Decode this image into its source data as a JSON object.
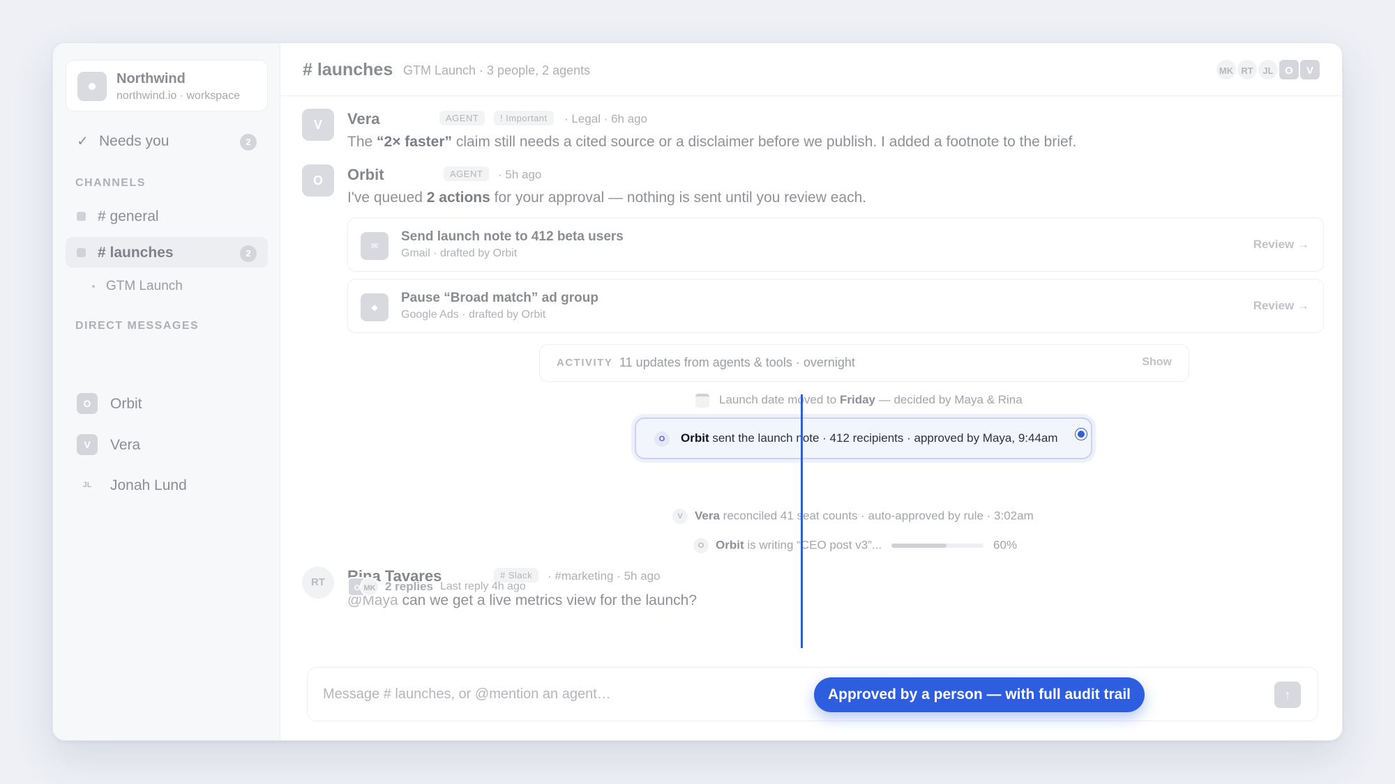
{
  "workspace": {
    "name": "Northwind",
    "subtitle": "northwind.io · workspace"
  },
  "sidebar": {
    "needs_you": {
      "label": "Needs you",
      "count": "2"
    },
    "channels_heading": "CHANNELS",
    "channels": [
      {
        "label": "# general"
      },
      {
        "label": "# launches",
        "count": "2"
      }
    ],
    "sub_item": "GTM Launch",
    "dm_heading": "DIRECT MESSAGES",
    "dms": [
      {
        "initials": "O",
        "label": "Orbit"
      },
      {
        "initials": "V",
        "label": "Vera"
      },
      {
        "initials": "JL",
        "label": "Jonah Lund"
      }
    ]
  },
  "header": {
    "title": "# launches",
    "meta": "GTM Launch · 3 people, 2 agents",
    "avatars": [
      "MK",
      "RT",
      "JL",
      "O",
      "V"
    ]
  },
  "messages": {
    "vera": {
      "avatar": "V",
      "name": "Vera",
      "badge": "AGENT",
      "tag": "! Important",
      "meta": "· Legal · 6h ago",
      "text_pre": "The ",
      "text_bold": "“2× faster”",
      "text_post": " claim still needs a cited source or a disclaimer before we publish. I added a footnote to the brief."
    },
    "orbit": {
      "avatar": "O",
      "name": "Orbit",
      "badge": "AGENT",
      "meta": "· 5h ago",
      "text_pre": "I've queued ",
      "text_bold": "2 actions",
      "text_post": " for your approval — nothing is sent until you review each."
    },
    "rina": {
      "avatar": "RT",
      "name": "Rina Tavares",
      "tag": "# Slack",
      "meta": "· #marketing · 5h ago",
      "mention": "@Maya",
      "text": " can we get a live metrics view for the launch?",
      "reply_avatars": [
        "O",
        "MK"
      ],
      "replies": "2 replies",
      "last_reply": "Last reply 4h ago"
    }
  },
  "actions": [
    {
      "icon": "✉",
      "title": "Send launch note to 412 beta users",
      "subtitle": "Gmail · drafted by Orbit",
      "cta": "Review →"
    },
    {
      "icon": "◆",
      "title": "Pause “Broad match” ad group",
      "subtitle": "Google Ads · drafted by Orbit",
      "cta": "Review →"
    }
  ],
  "activity": {
    "label": "ACTIVITY",
    "summary": "11 updates from agents & tools · overnight",
    "show": "Show"
  },
  "log": {
    "date_pre": "Launch date moved to ",
    "date_bold": "Friday",
    "date_post": " — decided by Maya & Rina",
    "sent_av": "O",
    "sent_name": "Orbit",
    "sent_text": " sent the launch note · 412 recipients · approved by Maya, 9:44am",
    "rec_av": "V",
    "rec_name": "Vera",
    "rec_text": " reconciled 41 seat counts · auto-approved by rule · 3:02am",
    "writing_av": "O",
    "writing_name": "Orbit",
    "writing_text": " is writing “CEO post v3”...",
    "writing_percent": "60%",
    "writing_progress": 0.6
  },
  "composer": {
    "placeholder": "Message # launches, or @mention an agent…",
    "send": "↑"
  },
  "callout": {
    "text": "Approved by a person — with full audit trail"
  },
  "colors": {
    "accent": "#2d5ee0"
  }
}
